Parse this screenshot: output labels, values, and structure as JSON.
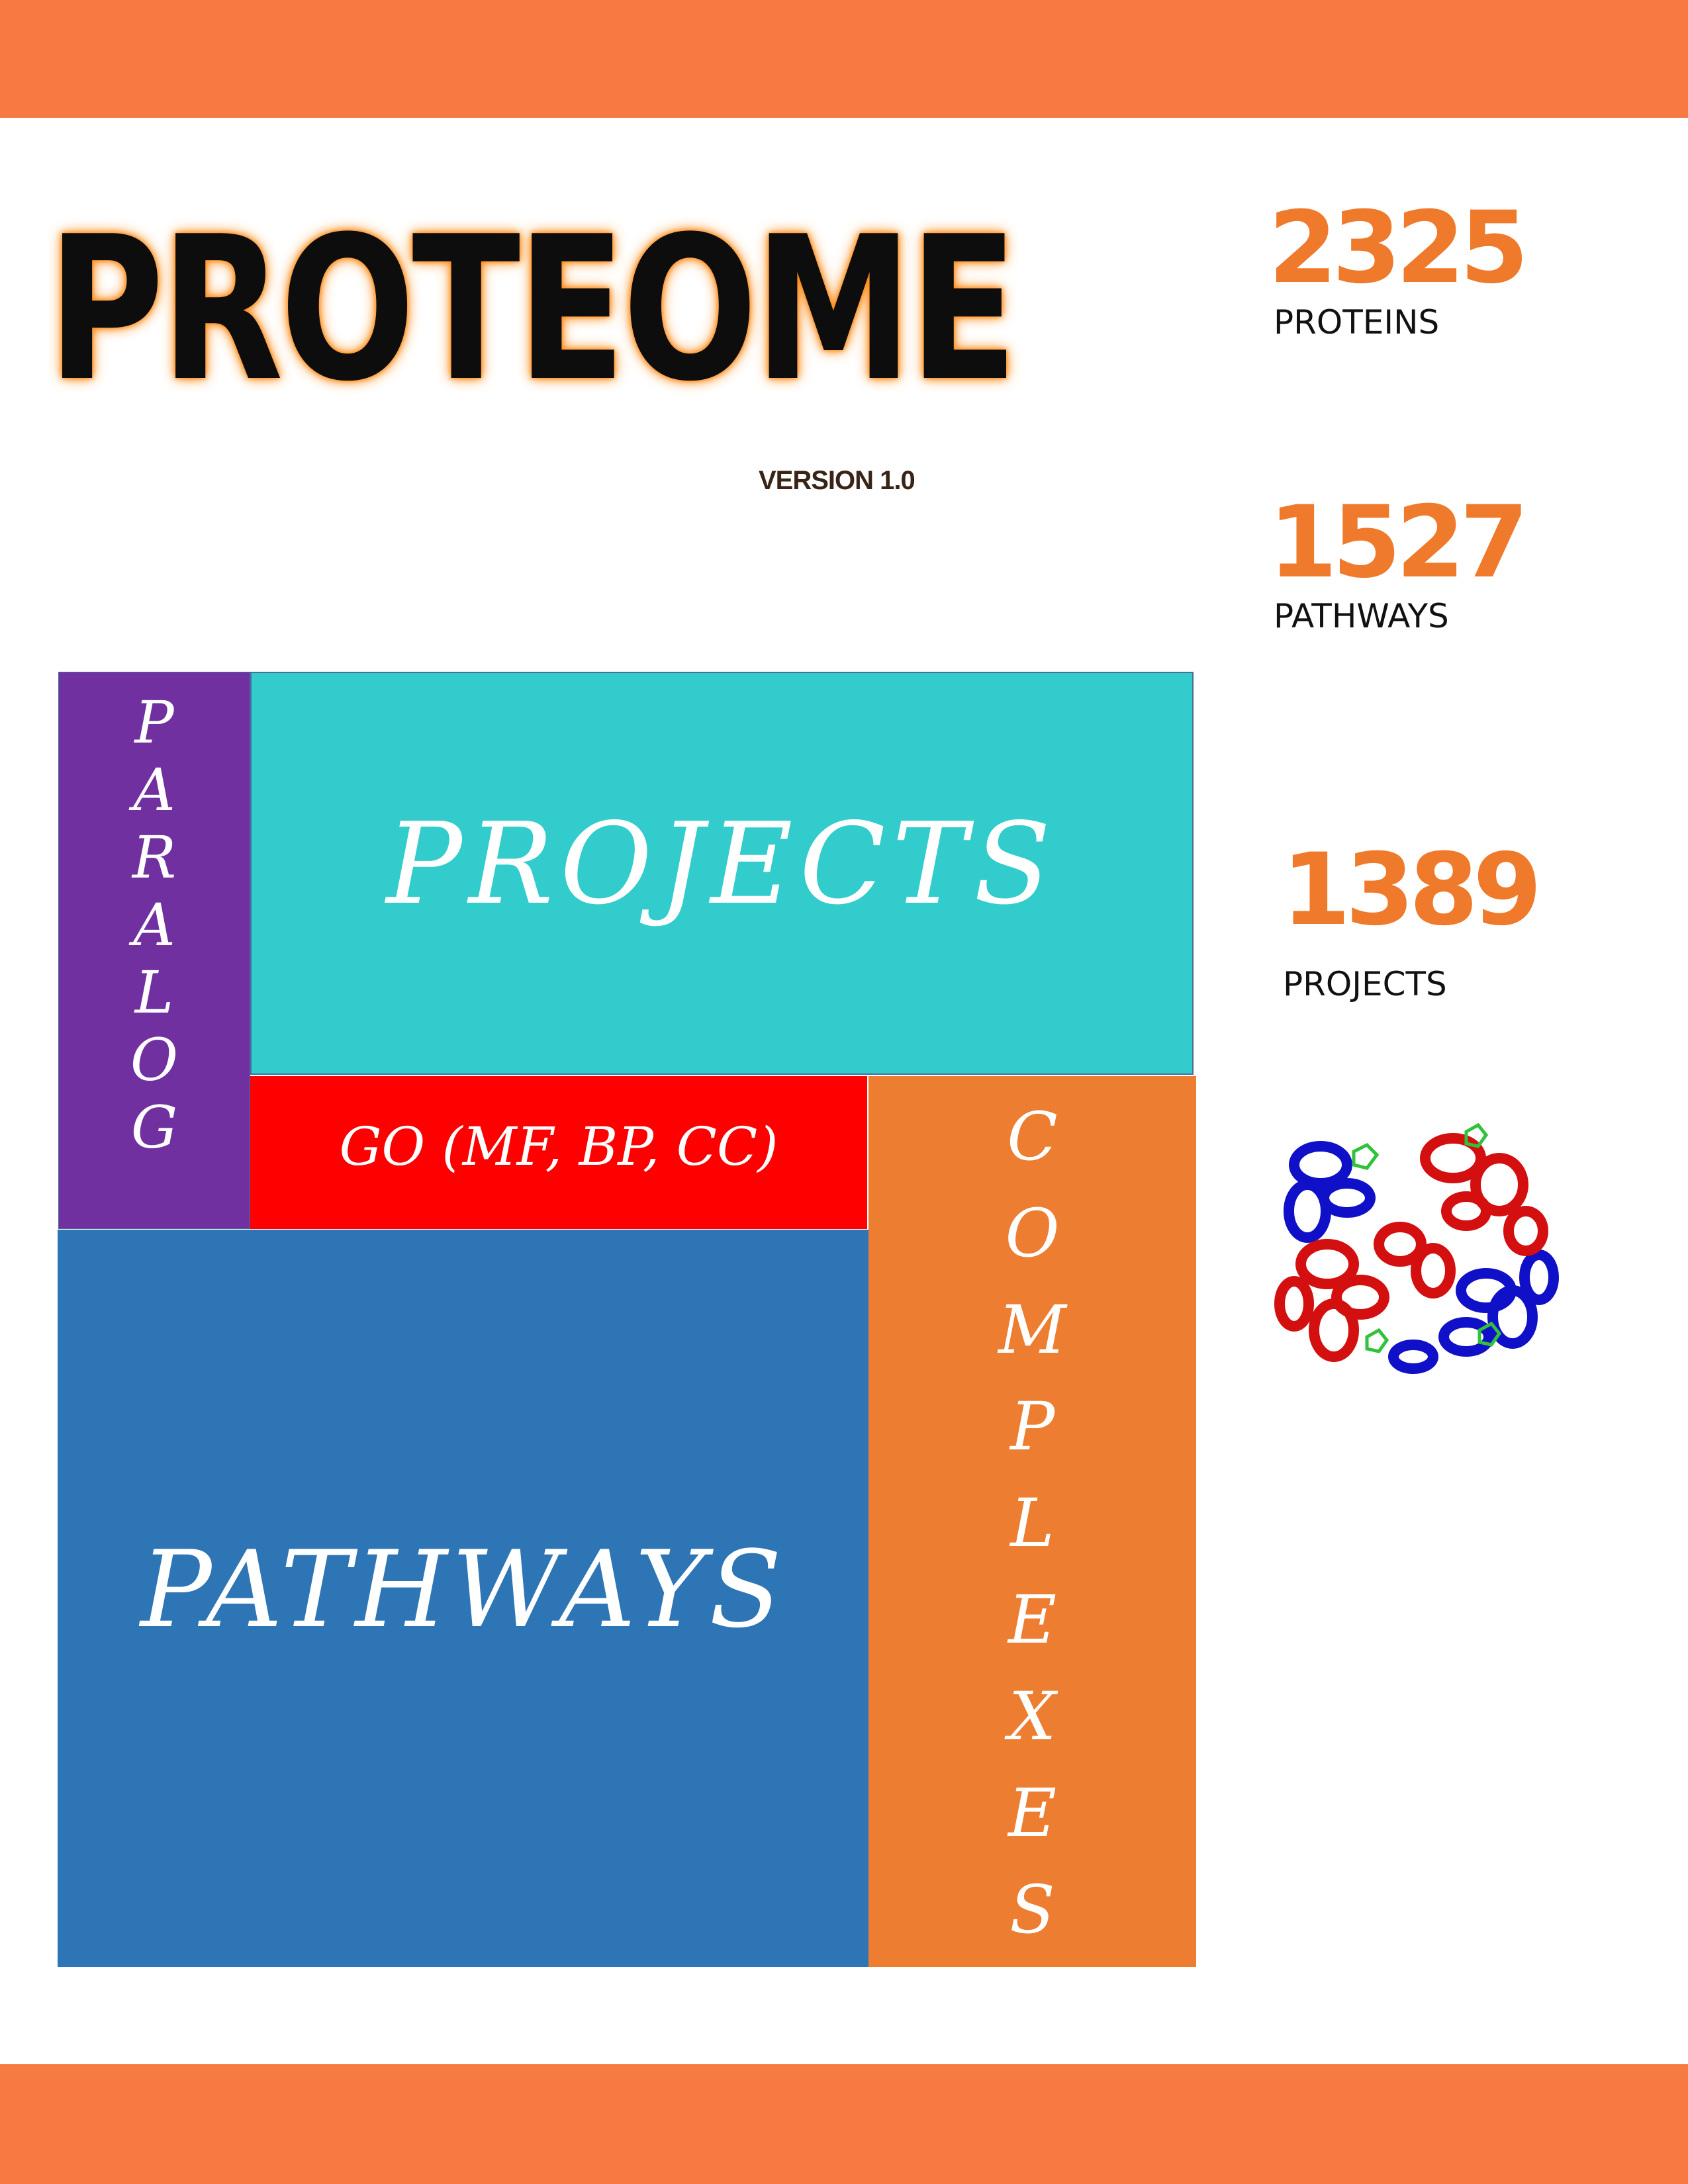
{
  "header": {
    "title": "PROTEOME",
    "version": "VERSION 1.0"
  },
  "stats": [
    {
      "value": "2325",
      "label": "PROTEINS"
    },
    {
      "value": "1527",
      "label": "PATHWAYS"
    },
    {
      "value": "1389",
      "label": "PROJECTS"
    }
  ],
  "tiles": {
    "paralog": [
      "P",
      "A",
      "R",
      "A",
      "L",
      "O",
      "G"
    ],
    "projects": "PROJECTS",
    "go": "GO (MF, BP, CC)",
    "complexes": [
      "C",
      "O",
      "M",
      "P",
      "L",
      "E",
      "X",
      "E",
      "S"
    ],
    "pathways": "PATHWAYS"
  },
  "colors": {
    "band": "#f77a42",
    "stat_number": "#ef7a2c",
    "paralog": "#7030a0",
    "projects": "#33cccc",
    "go": "#ff0000",
    "complexes": "#ed7d31",
    "pathways": "#2e75b6"
  },
  "image": {
    "icon": "protein-structure-icon"
  }
}
